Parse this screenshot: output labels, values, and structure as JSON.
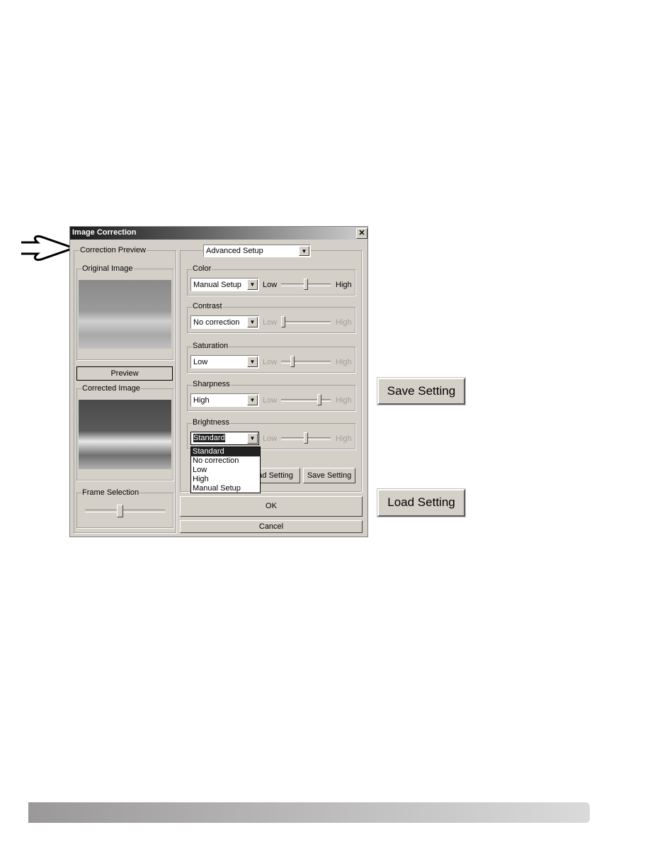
{
  "dialog": {
    "title": "Image Correction",
    "close_icon": "close-icon",
    "correction_preview_label": "Correction Preview",
    "original_image_label": "Original Image",
    "preview_button": "Preview",
    "corrected_image_label": "Corrected Image",
    "frame_selection_label": "Frame Selection",
    "frame_selection_level": 0.4,
    "mode_select": "Advanced Setup",
    "low": "Low",
    "high": "High",
    "groups": [
      {
        "label": "Color",
        "value": "Manual Setup",
        "enabled": true,
        "level": 0.5
      },
      {
        "label": "Contrast",
        "value": "No correction",
        "enabled": false,
        "level": 0.0
      },
      {
        "label": "Saturation",
        "value": "Low",
        "enabled": false,
        "level": 0.2
      },
      {
        "label": "Sharpness",
        "value": "High",
        "enabled": false,
        "level": 0.8
      },
      {
        "label": "Brightness",
        "value": "Standard",
        "enabled": false,
        "level": 0.5
      }
    ],
    "dropdown_options": [
      "Standard",
      "No correction",
      "Low",
      "High",
      "Manual Setup"
    ],
    "dropdown_selected": "Standard",
    "load_setting_partial": "oad Setting",
    "save_setting": "Save Setting",
    "ok": "OK",
    "cancel": "Cancel"
  },
  "callouts": {
    "save_setting": "Save Setting",
    "load_setting": "Load Setting"
  }
}
